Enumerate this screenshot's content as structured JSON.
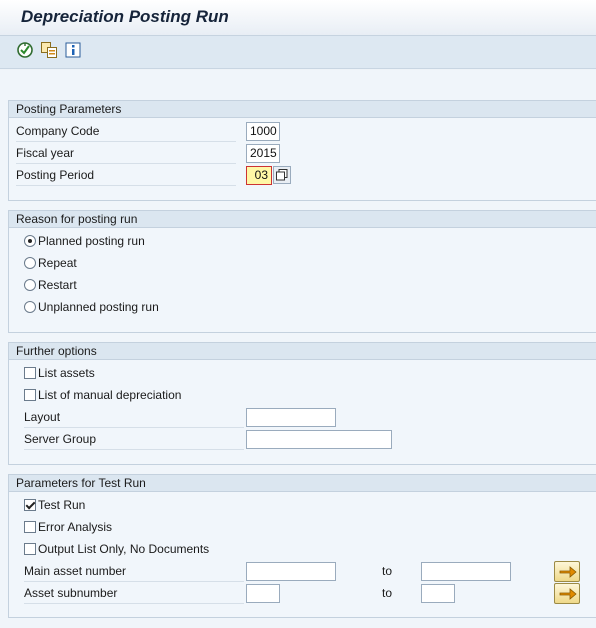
{
  "title": "Depreciation Posting Run",
  "toolbar": {
    "icons": [
      "execute-icon",
      "copy-variant-icon",
      "info-icon"
    ]
  },
  "posting": {
    "header": "Posting Parameters",
    "company_code_label": "Company Code",
    "company_code": "1000",
    "fiscal_year_label": "Fiscal year",
    "fiscal_year": "2015",
    "posting_period_label": "Posting Period",
    "posting_period": "03"
  },
  "reason": {
    "header": "Reason for posting run",
    "options": [
      "Planned posting run",
      "Repeat",
      "Restart",
      "Unplanned posting run"
    ],
    "selected": "Planned posting run"
  },
  "further": {
    "header": "Further options",
    "list_assets": "List assets",
    "list_manual": "List of manual depreciation",
    "layout_label": "Layout",
    "layout_value": "",
    "server_group_label": "Server Group",
    "server_group_value": ""
  },
  "test": {
    "header": "Parameters for Test Run",
    "test_run": "Test Run",
    "test_run_checked": true,
    "error_analysis": "Error Analysis",
    "output_list": "Output List Only, No Documents",
    "main_asset_label": "Main asset number",
    "asset_sub_label": "Asset subnumber",
    "to_label": "to"
  }
}
